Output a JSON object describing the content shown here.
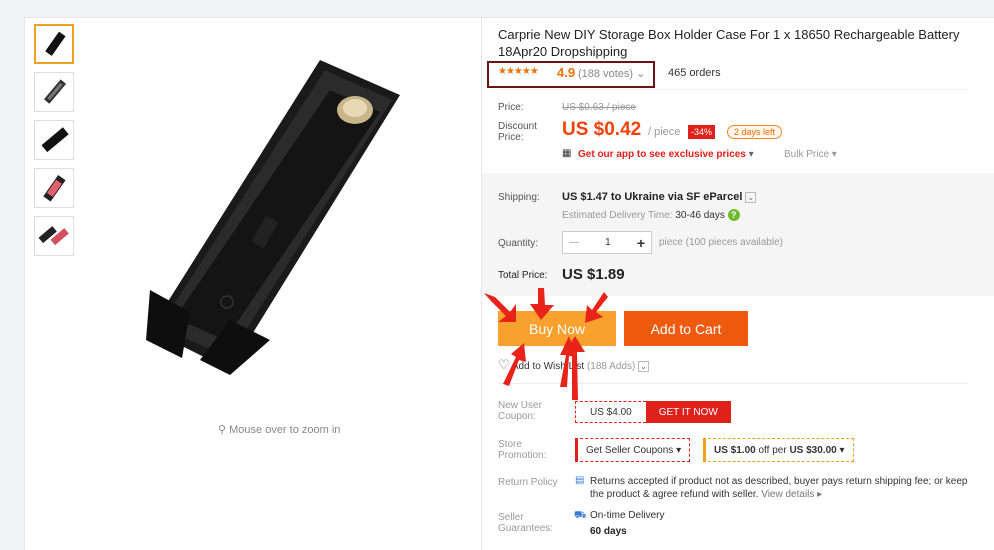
{
  "product": {
    "title": "Carprie New DIY Storage Box Holder Case For 1 x 18650 Rechargeable Battery 18Apr20 Dropshipping",
    "rating": "4.9",
    "votes": "(188 votes)",
    "orders": "465 orders"
  },
  "gallery": {
    "zoom_hint": "Mouse over to zoom in"
  },
  "pricing": {
    "price_label": "Price:",
    "old_price": "US $0.63 / piece",
    "discount_label": "Discount Price:",
    "price": "US $0.42",
    "unit": "/ piece",
    "discount": "-34%",
    "days_left": "2 days left",
    "app_promo": "Get our app to see exclusive prices",
    "bulk": "Bulk Price"
  },
  "shipping": {
    "label": "Shipping:",
    "value": "US $1.47 to Ukraine via SF eParcel",
    "delivery_label": "Estimated Delivery Time:",
    "delivery_value": "30-46 days"
  },
  "quantity": {
    "label": "Quantity:",
    "value": "1",
    "note": "piece (100 pieces available)"
  },
  "total": {
    "label": "Total Price:",
    "value": "US $1.89"
  },
  "actions": {
    "buy_now": "Buy Now",
    "add_to_cart": "Add to Cart",
    "wish_list": "Add to Wish List",
    "wish_count": "(188 Adds)"
  },
  "coupons": {
    "new_user_label": "New User Coupon:",
    "new_user_amount": "US $4.00",
    "get_it_now": "GET IT NOW",
    "store_label": "Store Promotion:",
    "seller_coupons": "Get Seller Coupons",
    "promo_amount": "US $1.00",
    "promo_mid": "off per",
    "promo_threshold": "US $30.00"
  },
  "policy": {
    "return_label": "Return Policy",
    "return_text": "Returns accepted if product not as described, buyer pays return shipping fee; or keep the product & agree refund with seller.",
    "view_details": "View details",
    "guarantee_label": "Seller Guarantees:",
    "ontime": "On-time Delivery",
    "ontime_days": "60 days"
  },
  "colors": {
    "price": "#f0430a",
    "buy_now": "#f9a12f",
    "add_to_cart": "#ee5a0e",
    "annotation": "#e8231a",
    "rating_box": "#6b1414"
  }
}
